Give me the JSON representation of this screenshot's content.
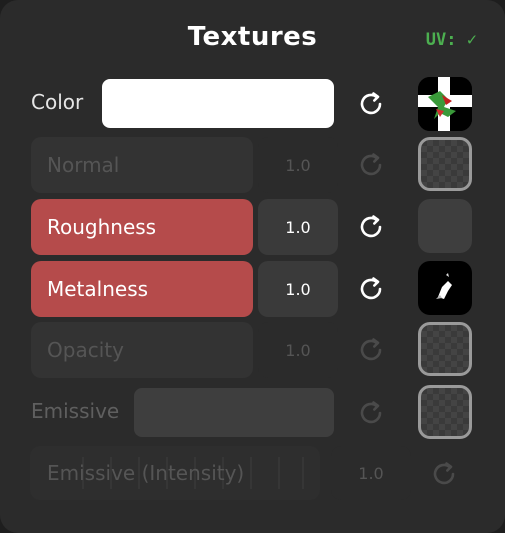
{
  "header": {
    "title": "Textures",
    "uv_label": "UV:",
    "uv_check": "✓"
  },
  "rows": {
    "color": {
      "label": "Color",
      "swatch_color": "#ffffff"
    },
    "normal": {
      "label": "Normal",
      "value": "1.0"
    },
    "roughness": {
      "label": "Roughness",
      "value": "1.0"
    },
    "metalness": {
      "label": "Metalness",
      "value": "1.0"
    },
    "opacity": {
      "label": "Opacity",
      "value": "1.0"
    },
    "emissive": {
      "label": "Emissive",
      "swatch_color": "#3e3e3e"
    },
    "emissive_intensity": {
      "label": "Emissive (Intensity)",
      "value": "1.0"
    }
  },
  "colors": {
    "accent_active": "#b54b4b",
    "uv_ok": "#4caf50"
  }
}
